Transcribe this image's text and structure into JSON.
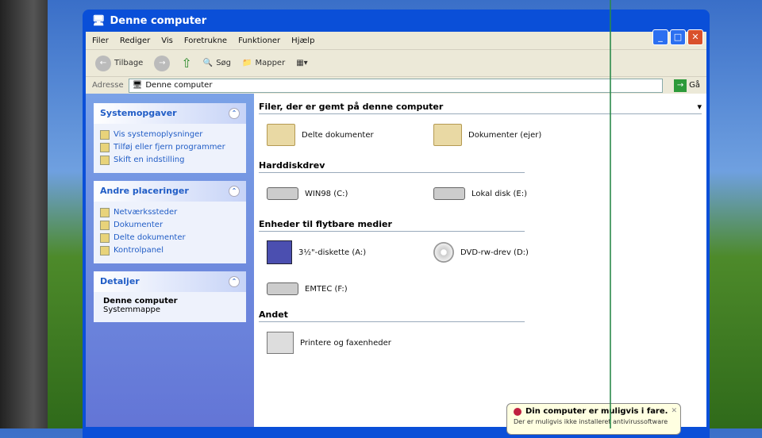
{
  "window": {
    "title": "Denne computer",
    "min": "_",
    "max": "□",
    "close": "✕"
  },
  "menu": [
    "Filer",
    "Rediger",
    "Vis",
    "Foretrukne",
    "Funktioner",
    "Hjælp"
  ],
  "toolbar": {
    "back": "Tilbage",
    "search": "Søg",
    "folders": "Mapper"
  },
  "address": {
    "label": "Adresse",
    "value": "Denne computer",
    "go": "Gå"
  },
  "sidebar": {
    "system": {
      "title": "Systemopgaver",
      "items": [
        "Vis systemoplysninger",
        "Tilføj eller fjern programmer",
        "Skift en indstilling"
      ]
    },
    "other": {
      "title": "Andre placeringer",
      "items": [
        "Netværkssteder",
        "Dokumenter",
        "Delte dokumenter",
        "Kontrolpanel"
      ]
    },
    "details": {
      "title": "Detaljer",
      "name": "Denne computer",
      "type": "Systemmappe"
    }
  },
  "main": {
    "g1": "Filer, der er gemt på denne computer",
    "shared": "Delte dokumenter",
    "docs": "Dokumenter (ejer)",
    "g2": "Harddiskdrev",
    "c": "WIN98 (C:)",
    "e": "Lokal disk (E:)",
    "g3": "Enheder til flytbare medier",
    "a": "3½\"-diskette (A:)",
    "d": "DVD-rw-drev (D:)",
    "f": "EMTEC (F:)",
    "g4": "Andet",
    "printers": "Printere og faxenheder"
  },
  "balloon": {
    "title": "Din computer er muligvis i fare.",
    "text": "Der er muligvis ikke installeret antivirussoftware"
  }
}
